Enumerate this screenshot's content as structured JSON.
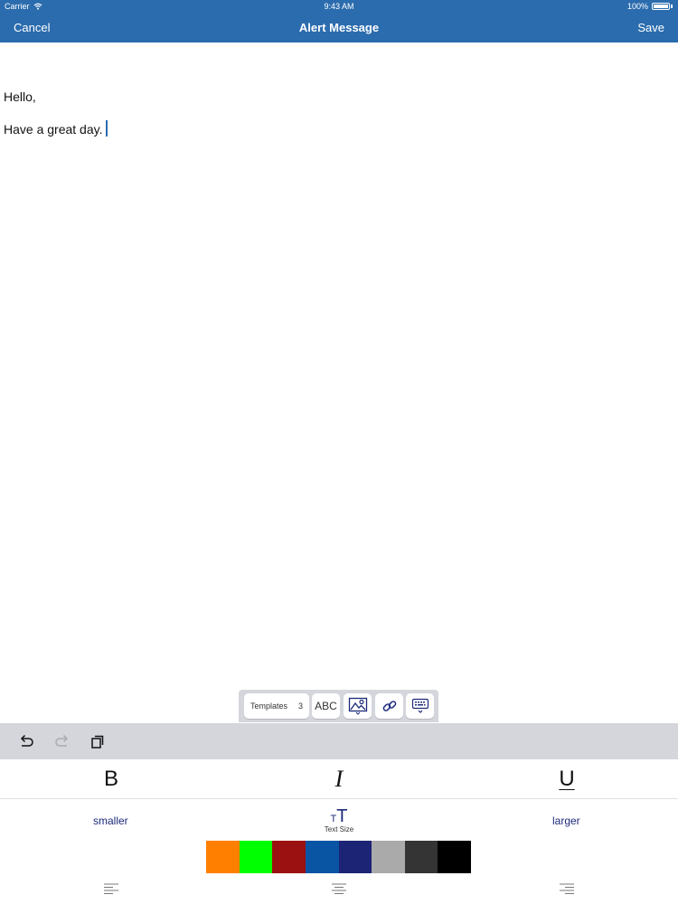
{
  "status_bar": {
    "carrier": "Carrier",
    "time": "9:43 AM",
    "battery": "100%",
    "battery_level": 1.0
  },
  "nav": {
    "cancel": "Cancel",
    "title": "Alert Message",
    "save": "Save"
  },
  "editor": {
    "lines": [
      "Hello,",
      "Have a great day."
    ]
  },
  "accessory": {
    "templates_label": "Templates",
    "templates_count": "3",
    "spell_label": "ABC"
  },
  "format": {
    "bold_label": "B",
    "italic_label": "I",
    "underline_label": "U"
  },
  "text_size": {
    "smaller": "smaller",
    "larger": "larger",
    "icon_small": "T",
    "icon_large": "T",
    "label": "Text Size"
  },
  "colors": [
    "#ff7f00",
    "#00ff00",
    "#9b1010",
    "#0a54a4",
    "#1b2475",
    "#aaaaaa",
    "#343434",
    "#000000"
  ],
  "icons": {
    "undo": "undo-icon",
    "redo": "redo-icon",
    "paste": "paste-icon",
    "image": "image-icon",
    "link": "link-icon",
    "keyboard": "keyboard-dismiss-icon",
    "wifi": "wifi-icon",
    "battery": "battery-icon"
  }
}
